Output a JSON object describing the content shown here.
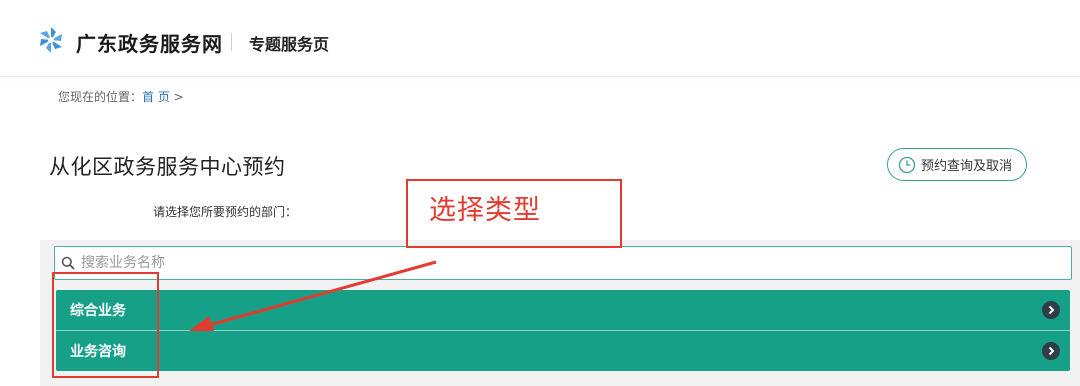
{
  "header": {
    "site_title": "广东政务服务网",
    "sub_title": "专题服务页"
  },
  "breadcrumb": {
    "prefix": "您现在的位置：",
    "home": "首 页",
    "separator": " >"
  },
  "page": {
    "title": "从化区政务服务中心预约",
    "query_button": "预约查询及取消",
    "prompt": "请选择您所要预约的部门："
  },
  "search": {
    "placeholder": "搜索业务名称",
    "value": ""
  },
  "categories": [
    {
      "label": "综合业务"
    },
    {
      "label": "业务咨询"
    }
  ],
  "annotation": {
    "text": "选择类型"
  },
  "colors": {
    "accent": "#17a088",
    "annotation": "#e23b2f",
    "link": "#2a6fb5",
    "logo": "#3d8fd6"
  },
  "icons": [
    "logo-icon",
    "clock-icon",
    "search-icon",
    "chevron-right-icon"
  ]
}
